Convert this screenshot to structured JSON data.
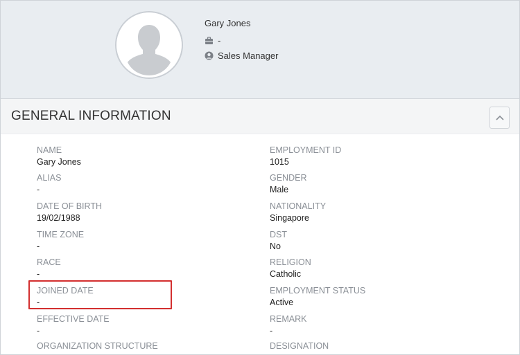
{
  "profile": {
    "name": "Gary Jones",
    "department": "-",
    "job_title": "Sales Manager"
  },
  "section": {
    "title": "GENERAL INFORMATION"
  },
  "fields_left": [
    {
      "label": "NAME",
      "value": "Gary Jones"
    },
    {
      "label": "ALIAS",
      "value": "-"
    },
    {
      "label": "DATE OF BIRTH",
      "value": "19/02/1988"
    },
    {
      "label": "TIME ZONE",
      "value": "-"
    },
    {
      "label": "RACE",
      "value": "-"
    },
    {
      "label": "JOINED DATE",
      "value": "-"
    },
    {
      "label": "EFFECTIVE DATE",
      "value": "-"
    },
    {
      "label": "ORGANIZATION STRUCTURE",
      "value": ""
    }
  ],
  "fields_right": [
    {
      "label": "EMPLOYMENT ID",
      "value": "1015"
    },
    {
      "label": "GENDER",
      "value": "Male"
    },
    {
      "label": "NATIONALITY",
      "value": "Singapore"
    },
    {
      "label": "DST",
      "value": "No"
    },
    {
      "label": "RELIGION",
      "value": "Catholic"
    },
    {
      "label": "EMPLOYMENT STATUS",
      "value": "Active"
    },
    {
      "label": "REMARK",
      "value": "-"
    },
    {
      "label": "DESIGNATION",
      "value": ""
    }
  ],
  "colors": {
    "header_bg": "#e9edf1",
    "section_bg": "#f4f5f6",
    "label": "#8a8f96",
    "value": "#222222",
    "highlight": "#d32f2f"
  },
  "icons": {
    "avatar": "person-silhouette-icon",
    "department": "briefcase-icon",
    "job_title": "user-circle-icon",
    "collapse": "chevron-up-icon"
  }
}
